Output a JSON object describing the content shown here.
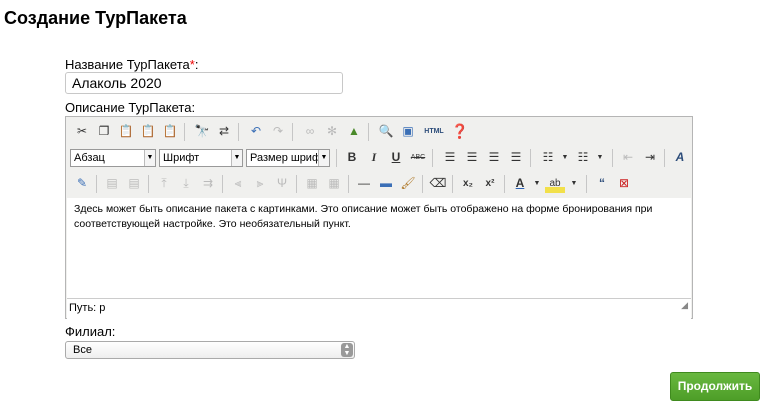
{
  "page": {
    "title": "Создание ТурПакета"
  },
  "form": {
    "name_label": "Название ТурПакета",
    "required_mark": "*",
    "name_colon": ":",
    "name_value": "Алаколь 2020",
    "description_label": "Описание ТурПакета:",
    "branch_label": "Филиал:",
    "branch_value": "Все",
    "continue_label": "Продолжить"
  },
  "editor": {
    "format_dropdown": "Абзац",
    "font_dropdown": "Шрифт",
    "size_dropdown": "Размер шрифта",
    "html_label": "HTML",
    "content": "Здесь может быть описание пакета с картинками. Это описание может быть отображено на форме бронирования при соответствующей настройке. Это необязательный пункт.",
    "status_path": "Путь: p"
  },
  "colors": {
    "accent_green": "#5aaa32",
    "required": "#e00000"
  }
}
